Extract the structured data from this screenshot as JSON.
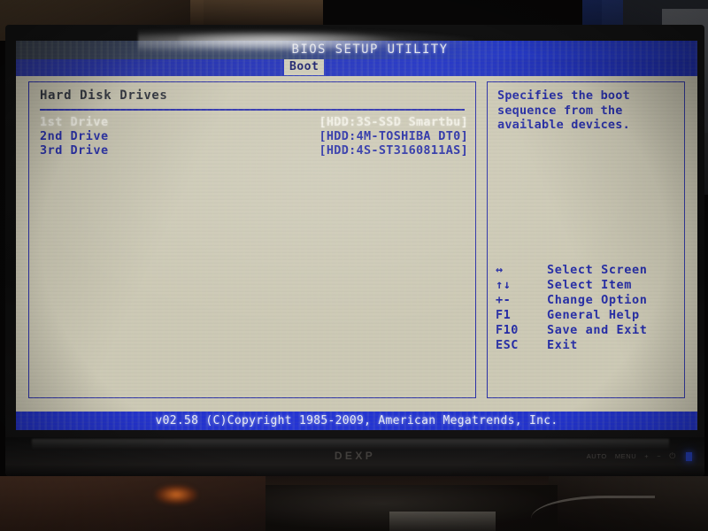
{
  "screen": {
    "title": "BIOS SETUP UTILITY",
    "active_tab": "Boot",
    "section_title": "Hard Disk Drives",
    "drives": [
      {
        "label": "1st Drive",
        "value": "[HDD:3S-SSD Smartbu]",
        "selected": true
      },
      {
        "label": "2nd Drive",
        "value": "[HDD:4M-TOSHIBA DT0]",
        "selected": false
      },
      {
        "label": "3rd Drive",
        "value": "[HDD:4S-ST3160811AS]",
        "selected": false
      }
    ],
    "help": {
      "text": "Specifies the boot sequence from the available devices."
    },
    "keys": [
      {
        "key": "↔",
        "desc": "Select Screen"
      },
      {
        "key": "↑↓",
        "desc": "Select Item"
      },
      {
        "key": "+-",
        "desc": "Change Option"
      },
      {
        "key": "F1",
        "desc": "General Help"
      },
      {
        "key": "F10",
        "desc": "Save and Exit"
      },
      {
        "key": "ESC",
        "desc": "Exit"
      }
    ],
    "footer": "v02.58 (C)Copyright 1985-2009, American Megatrends, Inc."
  },
  "monitor": {
    "brand": "DEXP",
    "buttons": [
      "AUTO",
      "MENU",
      "+",
      "−",
      "⏻"
    ]
  },
  "colors": {
    "accent_blue": "#2229a6",
    "title_blue": "#2436c6",
    "screen_bg": "#cdc9b6",
    "selected_text": "#f2f0e6",
    "led": "#2a4df0"
  }
}
